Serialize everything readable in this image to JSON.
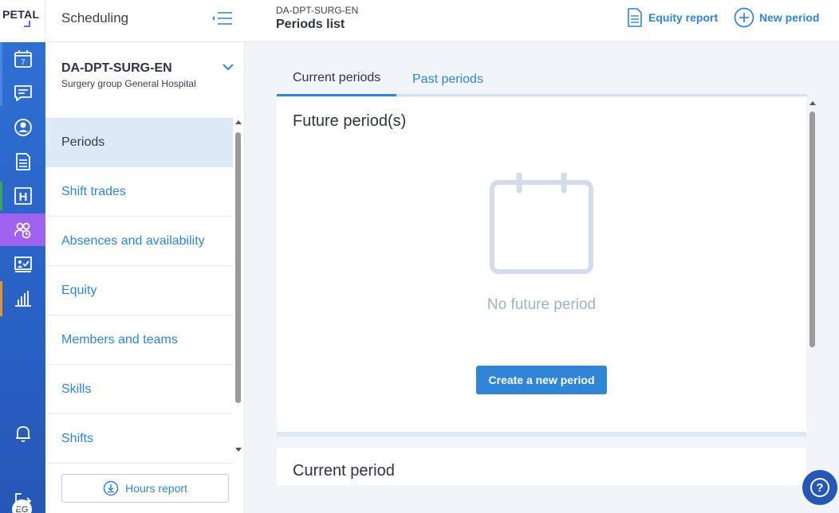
{
  "logo": {
    "text": "PETAL"
  },
  "sidebar": {
    "title": "Scheduling",
    "org_name": "DA-DPT-SURG-EN",
    "org_sub": "Surgery group General Hospital",
    "items": [
      {
        "label": "Periods",
        "active": true
      },
      {
        "label": "Shift trades"
      },
      {
        "label": "Absences and availability"
      },
      {
        "label": "Equity"
      },
      {
        "label": "Members and teams"
      },
      {
        "label": "Skills"
      },
      {
        "label": "Shifts"
      }
    ],
    "hours_report_label": "Hours report"
  },
  "rail": {
    "items": [
      "calendar-icon",
      "chat-icon",
      "user-icon",
      "document-icon",
      "hospital-icon",
      "scheduling-group-icon",
      "presentation-check-icon",
      "bar-chart-icon"
    ],
    "active": "scheduling-group-icon",
    "calendar_day": "7",
    "hospital_letter": "H",
    "avatar_initials": "EG"
  },
  "header": {
    "breadcrumb": "DA-DPT-SURG-EN",
    "title": "Periods list",
    "equity_report_label": "Equity report",
    "new_period_label": "New period"
  },
  "tabs": [
    {
      "label": "Current periods",
      "active": true
    },
    {
      "label": "Past periods",
      "active": false
    }
  ],
  "future": {
    "title": "Future period(s)",
    "empty_text": "No future period",
    "create_label": "Create a new period"
  },
  "current": {
    "title": "Current period"
  },
  "help_label": "?",
  "colors": {
    "accent": "#2f86d9",
    "rail": "#2f6fd4",
    "rail_active": "#a063f0",
    "empty_text": "#a2b2c7"
  }
}
